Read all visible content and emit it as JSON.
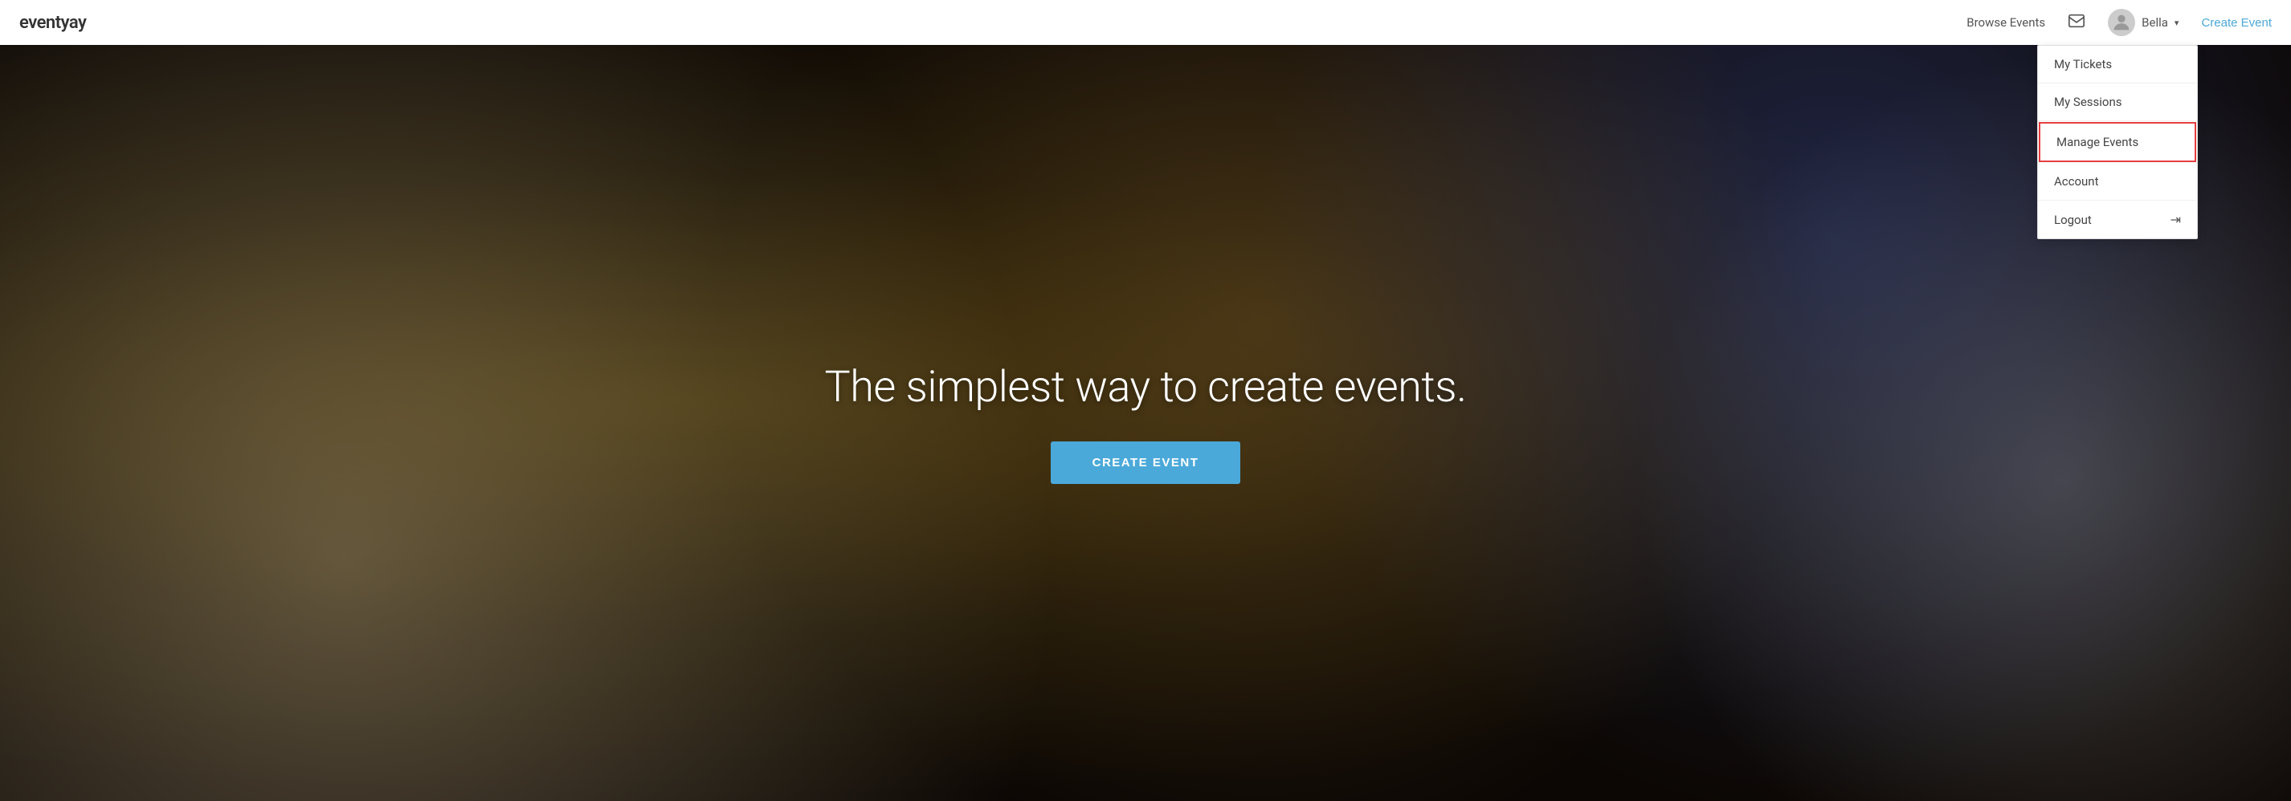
{
  "navbar": {
    "brand": "eventyay",
    "browse_events_label": "Browse Events",
    "username": "Bella",
    "create_event_label": "Create Event"
  },
  "dropdown": {
    "items": [
      {
        "id": "my-tickets",
        "label": "My Tickets",
        "highlighted": false
      },
      {
        "id": "my-sessions",
        "label": "My Sessions",
        "highlighted": false
      },
      {
        "id": "manage-events",
        "label": "Manage Events",
        "highlighted": true
      },
      {
        "id": "account",
        "label": "Account",
        "highlighted": false
      },
      {
        "id": "logout",
        "label": "Logout",
        "highlighted": false,
        "has_icon": true
      }
    ]
  },
  "hero": {
    "title": "The simplest way to create events.",
    "cta_label": "CREATE EVENT"
  }
}
